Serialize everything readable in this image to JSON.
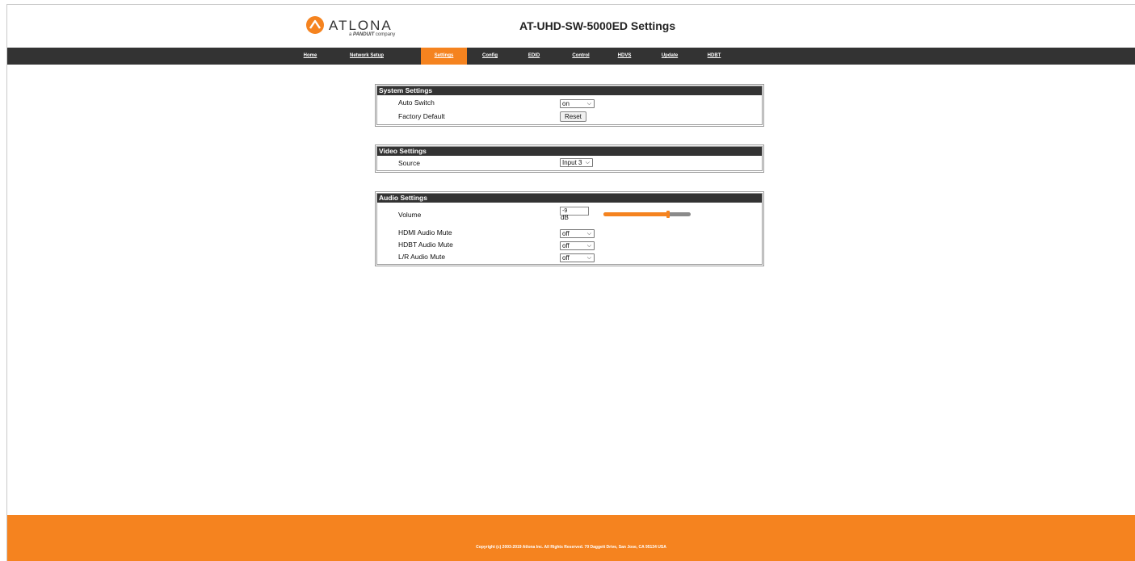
{
  "header": {
    "logo_text": "ATLONA",
    "logo_sub_prefix": "a",
    "logo_sub_brand": "PANDUIT",
    "logo_sub_suffix": "company",
    "title": "AT-UHD-SW-5000ED Settings"
  },
  "nav": {
    "items": [
      {
        "label": "Home"
      },
      {
        "label": "Network Setup"
      },
      {
        "label": "Settings"
      },
      {
        "label": "Config"
      },
      {
        "label": "EDID"
      },
      {
        "label": "Control"
      },
      {
        "label": "HDVS"
      },
      {
        "label": "Update"
      },
      {
        "label": "HDBT"
      }
    ],
    "active": "Settings"
  },
  "system_settings": {
    "title": "System Settings",
    "auto_switch_label": "Auto Switch",
    "auto_switch_value": "on",
    "factory_default_label": "Factory Default",
    "reset_label": "Reset"
  },
  "video_settings": {
    "title": "Video Settings",
    "source_label": "Source",
    "source_value": "Input 3"
  },
  "audio_settings": {
    "title": "Audio Settings",
    "volume_label": "Volume",
    "volume_value": "-9",
    "volume_unit": "dB",
    "volume_slider_fraction": 0.74,
    "hdmi_mute_label": "HDMI Audio Mute",
    "hdmi_mute_value": "off",
    "hdbt_mute_label": "HDBT Audio Mute",
    "hdbt_mute_value": "off",
    "lr_mute_label": "L/R Audio Mute",
    "lr_mute_value": "off"
  },
  "footer": {
    "copyright": "Copyright (c) 2003-2019 Atlona Inc. All Rights Reserved. 70 Daggett Drive, San Jose, CA 95134 USA"
  },
  "colors": {
    "accent": "#f5831f",
    "nav_bg": "#333333"
  }
}
